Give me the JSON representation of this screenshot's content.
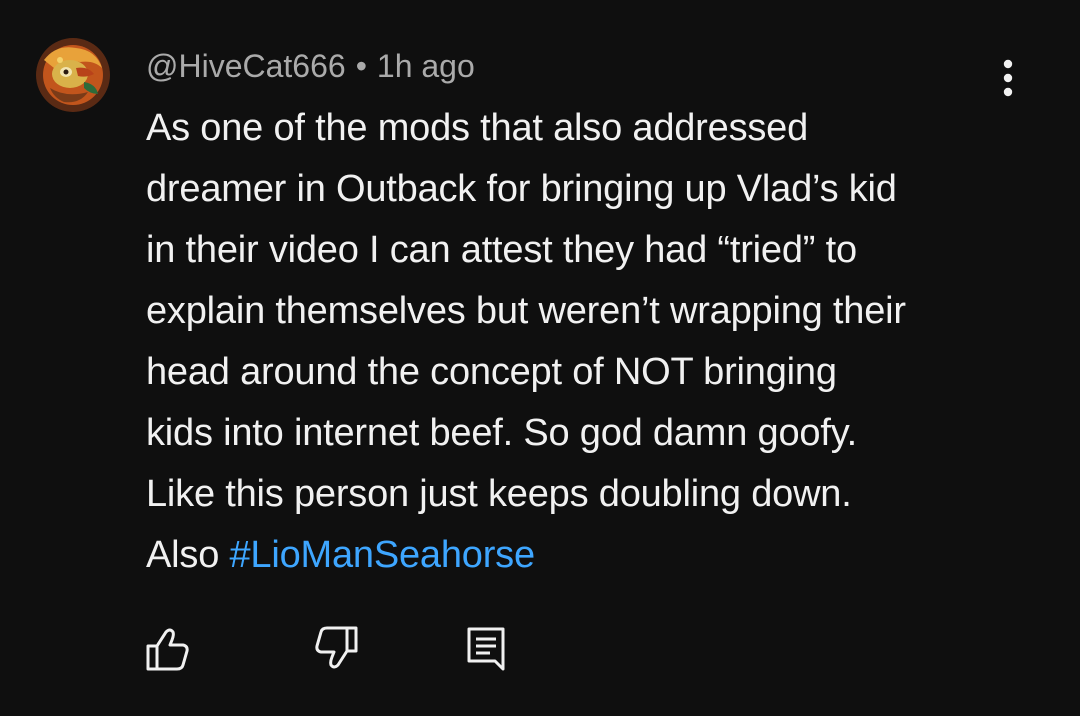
{
  "comment": {
    "username": "@HiveCat666",
    "separator": "•",
    "timestamp": "1h ago",
    "body_lines": [
      "As one of the mods that also addressed",
      "dreamer in Outback for bringing up Vlad’s kid",
      "in their video I can attest they had “tried” to",
      "explain themselves but weren’t wrapping their",
      "head around the concept of NOT bringing",
      "kids into internet beef. So god damn goofy.",
      "Like this person just keeps doubling down."
    ],
    "last_line_prefix": "Also ",
    "hashtag": "#LioManSeahorse"
  },
  "icons": {
    "avatar": "user-avatar",
    "menu": "more-vertical-icon",
    "like": "thumbs-up-icon",
    "dislike": "thumbs-down-icon",
    "reply": "comment-reply-icon"
  },
  "colors": {
    "background": "#0f0f0f",
    "text": "#f1f1f1",
    "meta": "#aaaaaa",
    "hashtag": "#3ea6ff"
  }
}
